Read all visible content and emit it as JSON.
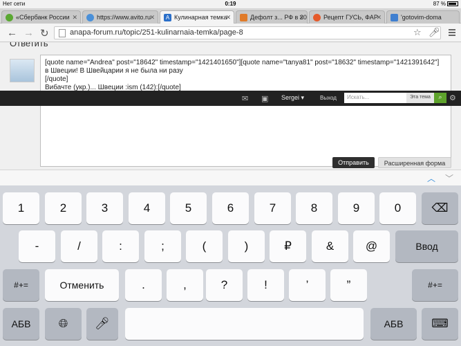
{
  "status": {
    "carrier": "Нет сети",
    "time": "0:19",
    "battery": "87 %"
  },
  "tabs": [
    {
      "label": "«Сбербанк России",
      "color": "#5aa832"
    },
    {
      "label": "https://www.avito.ru",
      "color": "#4a90d9"
    },
    {
      "label": "Кулинарная темка",
      "color": "#2a6fc9"
    },
    {
      "label": "Дефолт з... РФ в 20",
      "color": "#e07b2a"
    },
    {
      "label": "Рецепт ГУСЬ, ФАР",
      "color": "#e55a2b"
    },
    {
      "label": "'gotovim-doma",
      "color": "#3f7fd0"
    }
  ],
  "address": {
    "url": "anapa-forum.ru/topic/251-kulinarnaia-temka/page-8"
  },
  "reply": {
    "title": "Ответить",
    "lines": [
      "[quote name=\"Andrea\" post=\"18642\" timestamp=\"1421401650\"][quote name=\"tanya81\" post=\"18632\" timestamp=\"1421391642\"]",
      "в Швеции! В Швейцарии я не была ни разу",
      "[/quote]",
      "Вибачте (укр.)... Швеции :ism (142):[/quote]"
    ],
    "send_label": "Отправить",
    "advanced_label": "Расширенная форма"
  },
  "forum_bar": {
    "user": "Sergei ▾",
    "logout": "Выход",
    "search_placeholder": "Искать...",
    "scope": "Эта тема"
  },
  "keyboard": {
    "row1": [
      "1",
      "2",
      "3",
      "4",
      "5",
      "6",
      "7",
      "8",
      "9",
      "0"
    ],
    "row2": [
      "-",
      "/",
      ":",
      ";",
      "(",
      ")",
      "₽",
      "&",
      "@"
    ],
    "enter": "Ввод",
    "row3_left": "#+=",
    "undo": "Отменить",
    "row3": [
      ".",
      ",",
      "?",
      "!",
      "’",
      "”"
    ],
    "row3_right": "#+=",
    "abc": "АБВ",
    "abc_right": "АБВ"
  }
}
